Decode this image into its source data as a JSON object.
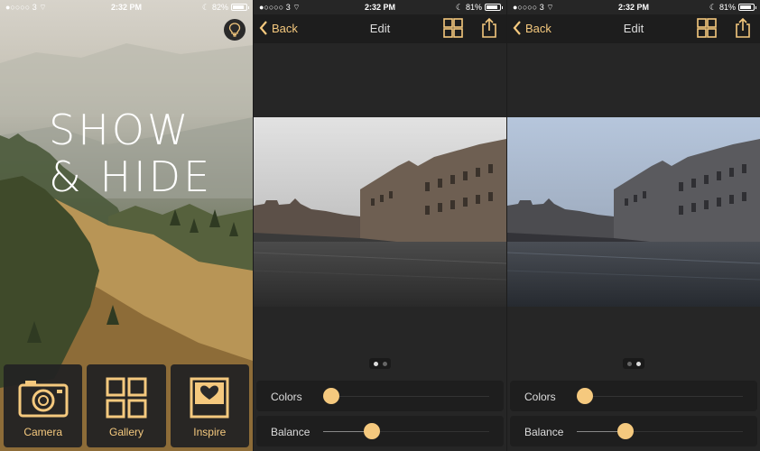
{
  "status_left": {
    "carrier": "3",
    "time": "2:32 PM",
    "battery": "82%"
  },
  "status_mid": {
    "carrier": "3",
    "time": "2:32 PM",
    "battery": "81%"
  },
  "status_right": {
    "carrier": "3",
    "time": "2:32 PM",
    "battery": "81%"
  },
  "home": {
    "hero_line1": "SHOW",
    "hero_line2": "& HIDE",
    "tiles": [
      {
        "label": "Camera",
        "icon": "camera-icon"
      },
      {
        "label": "Gallery",
        "icon": "grid-icon"
      },
      {
        "label": "Inspire",
        "icon": "heart-picture-icon"
      }
    ]
  },
  "editor_mid": {
    "back_label": "Back",
    "title": "Edit",
    "controls": [
      {
        "label": "Colors",
        "level": 0.0
      },
      {
        "label": "Balance",
        "level": 0.23
      }
    ],
    "page": 1,
    "pages": 2
  },
  "editor_right": {
    "back_label": "Back",
    "title": "Edit",
    "controls": [
      {
        "label": "Colors",
        "level": 0.0
      },
      {
        "label": "Balance",
        "level": 0.23
      }
    ],
    "page": 2,
    "pages": 2
  },
  "colors": {
    "accent": "#f5c97e",
    "panel": "#1e1e1e",
    "background": "#262626"
  }
}
